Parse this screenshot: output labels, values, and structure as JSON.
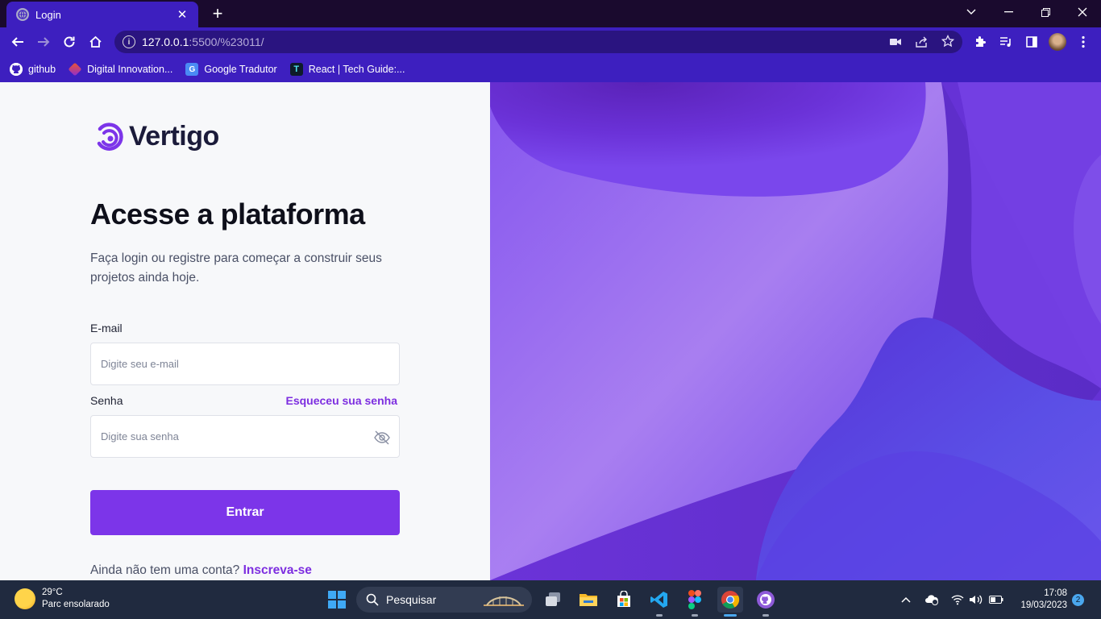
{
  "browser": {
    "tab_title": "Login",
    "url_host": "127.0.0.1",
    "url_rest": ":5500/%23011/",
    "bookmarks": [
      {
        "label": "github",
        "icon": "github-icon"
      },
      {
        "label": "Digital Innovation...",
        "icon": "dio-icon"
      },
      {
        "label": "Google Tradutor",
        "icon": "translate-icon"
      },
      {
        "label": "React | Tech Guide:...",
        "icon": "techguide-icon"
      }
    ]
  },
  "login": {
    "brand": "Vertigo",
    "heading": "Acesse a plataforma",
    "subtitle": "Faça login ou registre para começar a construir seus projetos ainda hoje.",
    "email_label": "E-mail",
    "email_placeholder": "Digite seu e-mail",
    "password_label": "Senha",
    "forgot_link": "Esqueceu sua senha",
    "password_placeholder": "Digite sua senha",
    "submit_label": "Entrar",
    "signup_prompt": "Ainda não tem uma conta?",
    "signup_link": "Inscreva-se",
    "accent_color": "#7c35e9"
  },
  "taskbar": {
    "weather_temp": "29°C",
    "weather_desc": "Parc ensolarado",
    "search_label": "Pesquisar",
    "time": "17:08",
    "date": "19/03/2023",
    "notification_count": "2"
  }
}
